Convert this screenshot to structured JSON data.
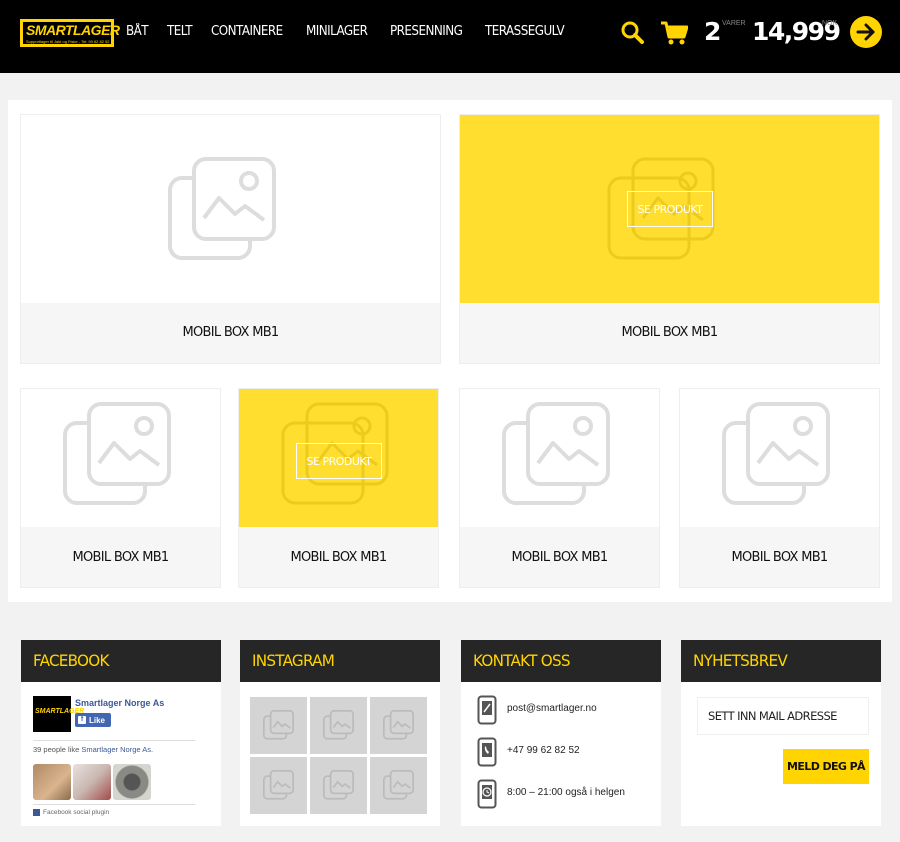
{
  "brand": {
    "logo_text": "SMARTLAGER",
    "logo_subtext": "Supportlager til Jakt og Fiske - Tel: 99 62 82 52"
  },
  "nav": {
    "items": [
      "BÅT",
      "TELT",
      "CONTAINERE",
      "MINILAGER",
      "PRESENNING",
      "TERASSEGULV"
    ]
  },
  "cart": {
    "count": "2",
    "count_label": "VARER",
    "total": "14,999",
    "total_label": "NOK"
  },
  "icons": {
    "search": "search-icon",
    "cart": "cart-icon",
    "checkout": "arrow-right-icon",
    "product_placeholder": "image-placeholder-icon"
  },
  "colors": {
    "accent": "#ffd400",
    "hover_card": "#ffde2f",
    "header_bg": "#000000",
    "footer_head_bg": "#262626"
  },
  "products": {
    "cta_label": "SE PRODUKT",
    "items": [
      {
        "label": "MOBIL BOX MB1",
        "hover": false
      },
      {
        "label": "MOBIL BOX MB1",
        "hover": true
      },
      {
        "label": "MOBIL BOX MB1",
        "hover": false
      },
      {
        "label": "MOBIL BOX MB1",
        "hover": true
      },
      {
        "label": "MOBIL BOX MB1",
        "hover": false
      },
      {
        "label": "MOBIL BOX MB1",
        "hover": false
      }
    ]
  },
  "footer": {
    "facebook": {
      "title": "FACEBOOK",
      "page_name": "Smartlager Norge As",
      "like_label": "Like",
      "people_prefix": "39 people like ",
      "people_link": "Smartlager Norge As",
      "people_suffix": ".",
      "plugin_label": "Facebook social plugin",
      "logo_text": "SMARTLAGER"
    },
    "instagram": {
      "title": "INSTAGRAM"
    },
    "contact": {
      "title": "KONTAKT OSS",
      "email": "post@smartlager.no",
      "phone": "+47 99 62 82 52",
      "hours": "8:00 – 21:00 også i helgen"
    },
    "newsletter": {
      "title": "NYHETSBREV",
      "placeholder": "SETT INN MAIL ADRESSE",
      "button_label": "MELD DEG PÅ"
    }
  }
}
